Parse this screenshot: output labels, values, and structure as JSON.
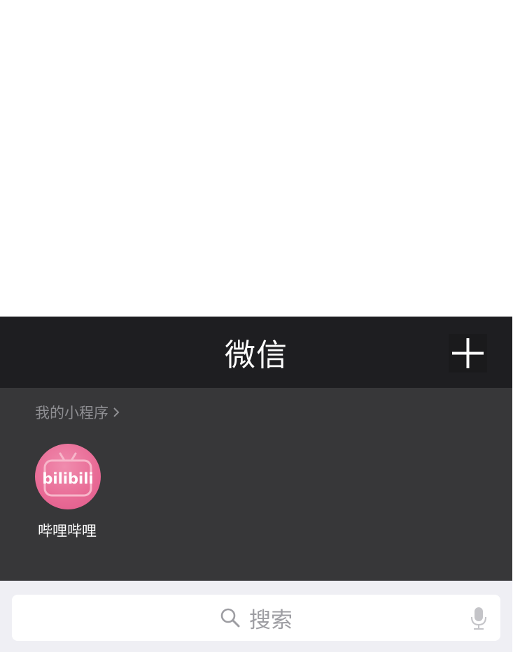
{
  "nav": {
    "title": "微信",
    "add_icon": "plus-icon"
  },
  "miniprograms": {
    "section_title": "我的小程序",
    "section_chevron_icon": "chevron-right-icon",
    "apps": [
      {
        "label": "哔哩哔哩",
        "icon": "bilibili-icon",
        "icon_text": "bilibili",
        "color": "#e86a95"
      }
    ]
  },
  "search": {
    "placeholder": "搜索",
    "search_icon": "search-icon",
    "voice_icon": "mic-icon"
  },
  "colors": {
    "nav_bg": "#1e1e21",
    "panel_bg": "#373739",
    "search_bg": "#efeff4",
    "muted_text": "#8e8e92"
  }
}
